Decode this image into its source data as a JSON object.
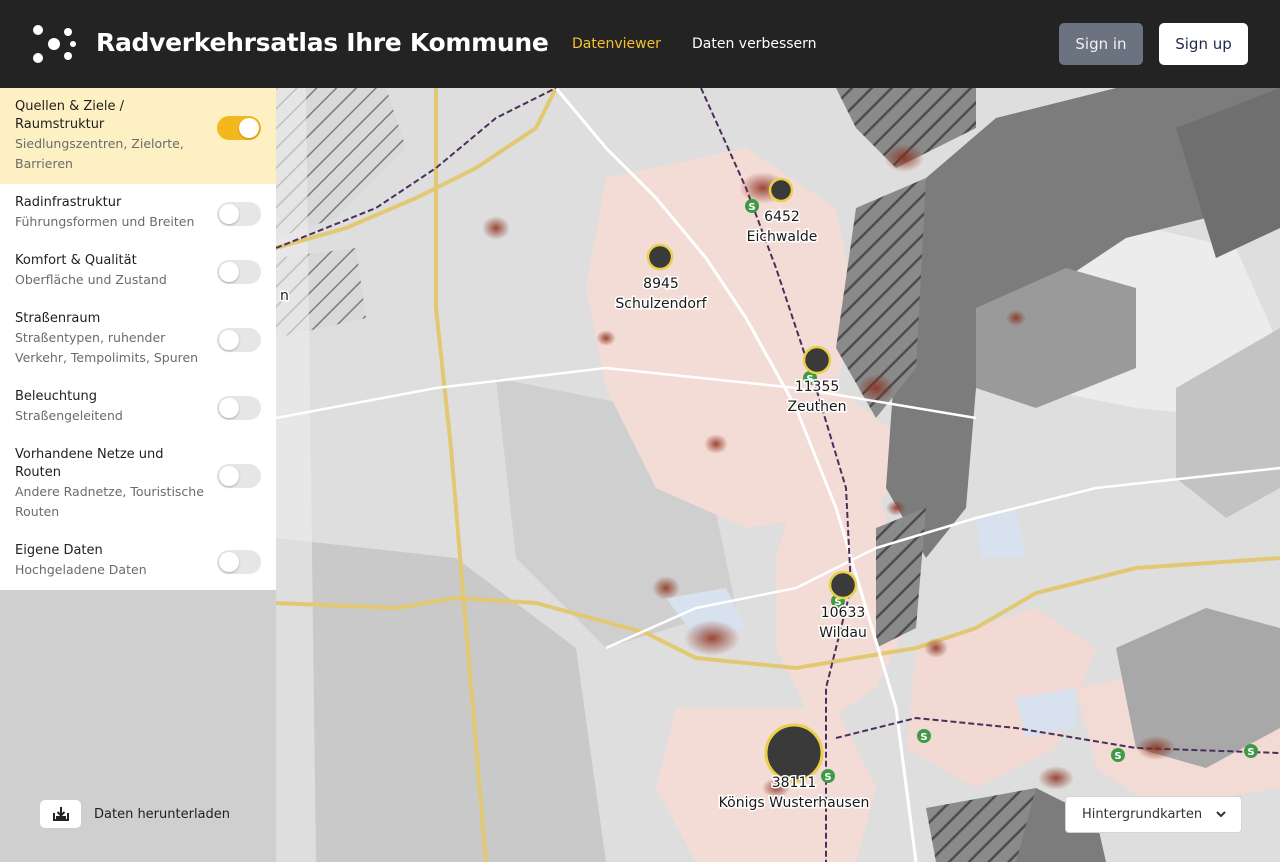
{
  "header": {
    "brand": "Radverkehrsatlas  Ihre Kommune",
    "nav": [
      "Datenviewer",
      "Daten verbessern"
    ],
    "sign_in": "Sign in",
    "sign_up": "Sign up"
  },
  "sidebar": {
    "layers": [
      {
        "title": "Quellen & Ziele / Raumstruktur",
        "subtitle": "Siedlungszentren, Zielorte, Barrieren",
        "on": true
      },
      {
        "title": "Radinfrastruktur",
        "subtitle": "Führungsformen und Breiten",
        "on": false
      },
      {
        "title": "Komfort & Qualität",
        "subtitle": "Oberfläche und Zustand",
        "on": false
      },
      {
        "title": "Straßenraum",
        "subtitle": "Straßentypen, ruhender Verkehr, Tempolimits, Spuren",
        "on": false
      },
      {
        "title": "Beleuchtung",
        "subtitle": "Straßengeleitend",
        "on": false
      },
      {
        "title": "Vorhandene Netze und Routen",
        "subtitle": "Andere Radnetze, Touristische Routen",
        "on": false
      },
      {
        "title": "Eigene Daten",
        "subtitle": "Hochgeladene Daten",
        "on": false
      }
    ],
    "download_label": "Daten herunterladen"
  },
  "map": {
    "places": [
      {
        "count": "6452",
        "name": "Eichwalde"
      },
      {
        "count": "8945",
        "name": "Schulzendorf"
      },
      {
        "count": "11355",
        "name": "Zeuthen"
      },
      {
        "count": "10633",
        "name": "Wildau"
      },
      {
        "count": "38111",
        "name": "Königs Wusterhausen"
      }
    ],
    "edge_label": "n",
    "station_glyph": "S",
    "basemap_label": "Hintergrundkarten"
  },
  "colors": {
    "accent": "#f5b81c",
    "topbar": "#232323",
    "active_layer_bg": "#fdf0c3",
    "road_major": "#e3c873",
    "settlement": "#f4dcd6",
    "water": "#7c7c7c"
  }
}
